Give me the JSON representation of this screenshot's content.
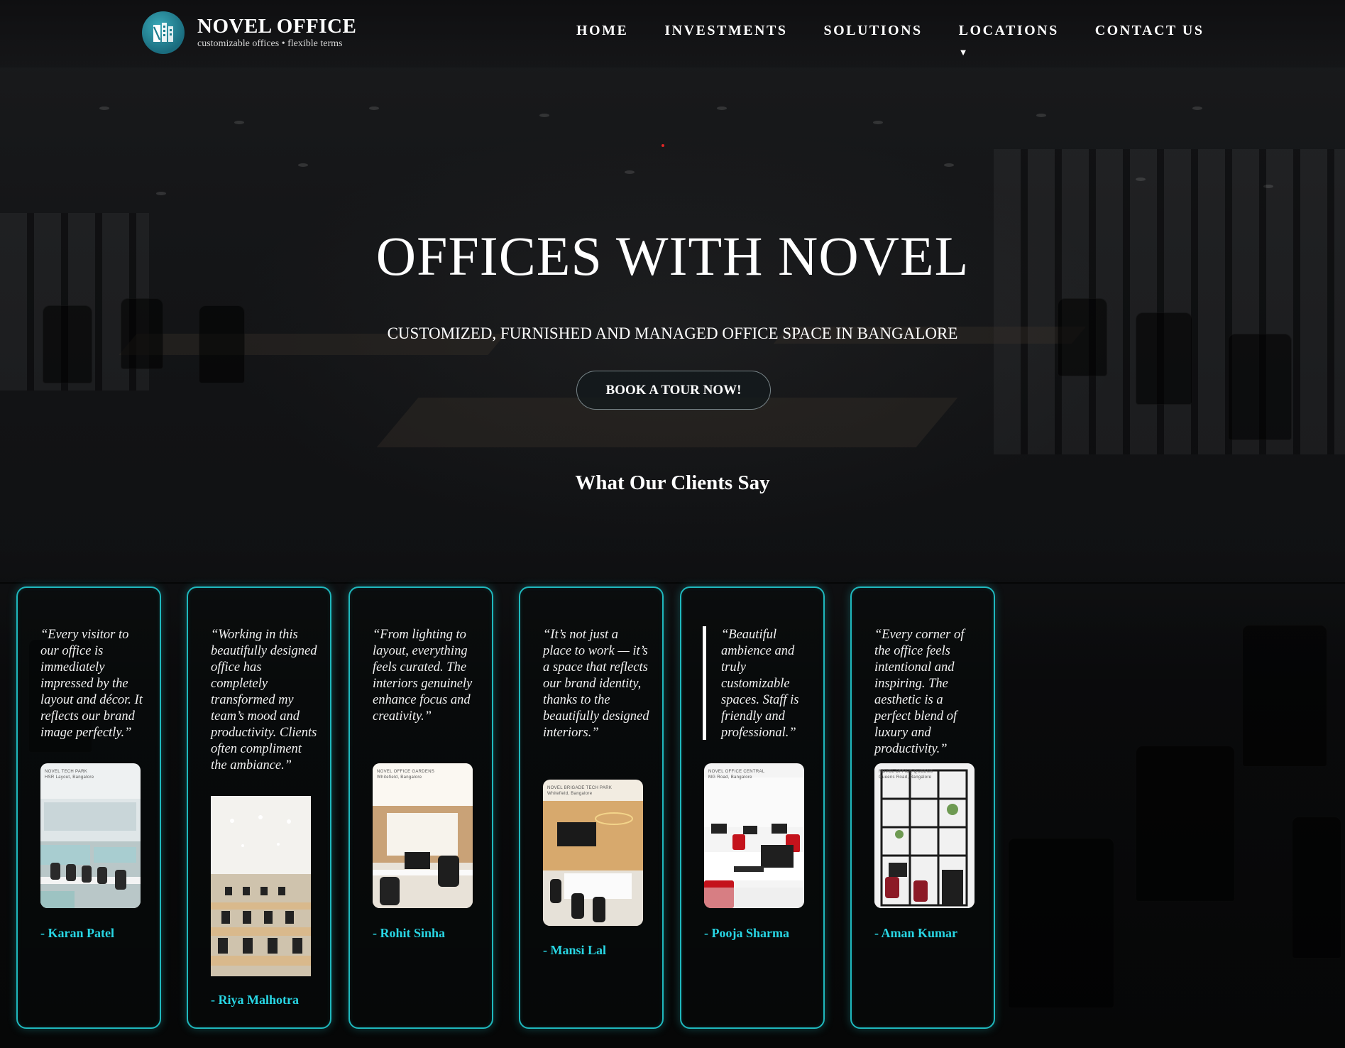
{
  "brand": {
    "name": "NOVEL OFFICE",
    "tagline": "customizable offices • flexible terms"
  },
  "nav": {
    "items": [
      "HOME",
      "INVESTMENTS",
      "SOLUTIONS",
      "LOCATIONS",
      "CONTACT US"
    ],
    "locations_caret": "▼"
  },
  "hero": {
    "title": "OFFICES WITH NOVEL",
    "subtitle": "CUSTOMIZED, FURNISHED AND MANAGED OFFICE SPACE IN BANGALORE",
    "cta": "BOOK A TOUR NOW!"
  },
  "testimonials": {
    "heading": "What Our Clients Say",
    "items": [
      {
        "quote": "“Every visitor to our office is immediately impressed by the layout and décor. It reflects our brand image perfectly.”",
        "author": "- Karan Patel",
        "photo_label": "NOVEL TECH PARK\nHSR Layout, Bangalore"
      },
      {
        "quote": "“Working in this beautifully designed office has completely transformed my team’s mood and productivity. Clients often compliment the ambiance.”",
        "author": "- Riya Malhotra",
        "photo_label": ""
      },
      {
        "quote": "“From lighting to layout, everything feels curated. The interiors genuinely enhance focus and creativity.”",
        "author": "- Rohit Sinha",
        "photo_label": "NOVEL OFFICE GARDENS\nWhitefield, Bangalore"
      },
      {
        "quote": "“It’s not just a place to work — it’s a space that reflects our brand identity, thanks to the beautifully designed interiors.”",
        "author": "- Mansi Lal",
        "photo_label": "NOVEL BRIGADE TECH PARK\nWhitefield, Bangalore"
      },
      {
        "quote": "“Beautiful ambience and truly customizable spaces. Staff is friendly and professional.”",
        "author": "- Pooja Sharma",
        "photo_label": "NOVEL OFFICE CENTRAL\nMG Road, Bangalore"
      },
      {
        "quote": "“Every corner of the office feels intentional and inspiring. The aesthetic is a perfect blend of luxury and productivity.”",
        "author": "- Aman Kumar",
        "photo_label": "NOVEL OFFICE QUEENS\nQueens Road, Bangalore"
      }
    ]
  },
  "colors": {
    "accent": "#1fb8bd",
    "author": "#28d6e4",
    "logo": "#2a8f9f",
    "cta_bg": "#141a1c"
  },
  "icons": {
    "logo": "building-logo-icon",
    "caret": "caret-down-icon"
  }
}
